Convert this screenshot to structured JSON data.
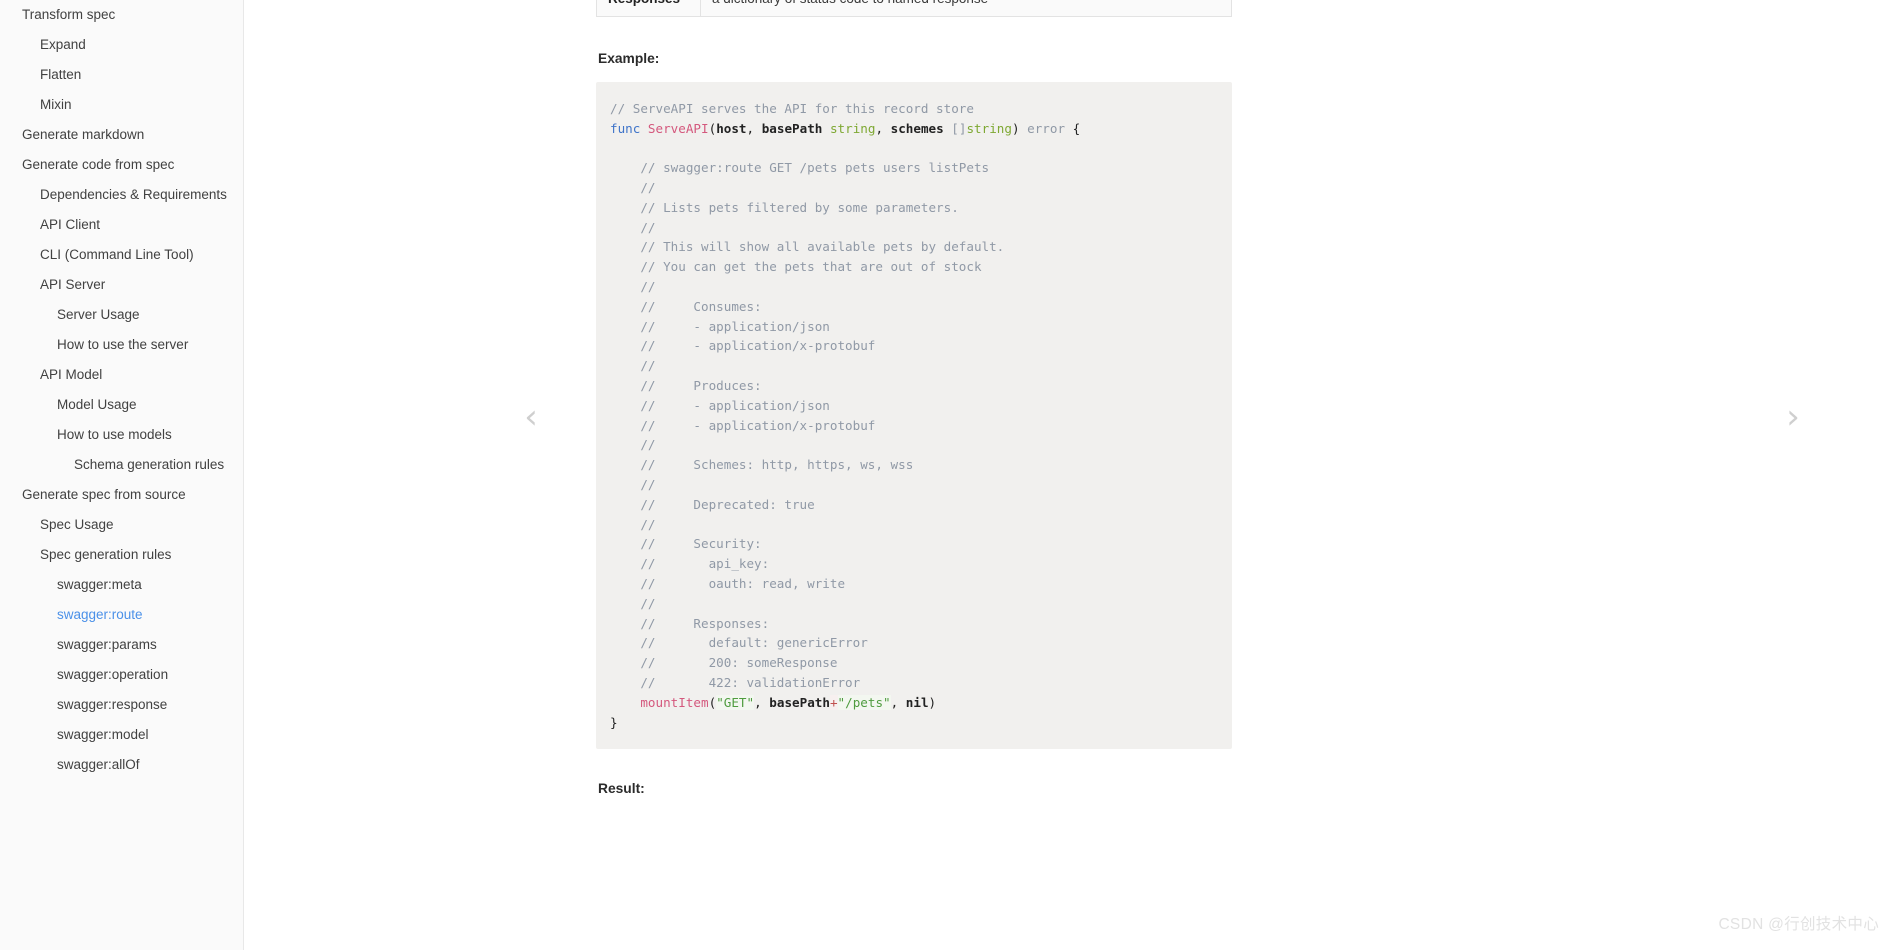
{
  "sidebar": {
    "items": [
      {
        "label": "Transform spec",
        "level": 0,
        "active": false
      },
      {
        "label": "Expand",
        "level": 1,
        "active": false
      },
      {
        "label": "Flatten",
        "level": 1,
        "active": false
      },
      {
        "label": "Mixin",
        "level": 1,
        "active": false
      },
      {
        "label": "Generate markdown",
        "level": 0,
        "active": false
      },
      {
        "label": "Generate code from spec",
        "level": 0,
        "active": false
      },
      {
        "label": "Dependencies & Requirements",
        "level": 1,
        "active": false
      },
      {
        "label": "API Client",
        "level": 1,
        "active": false
      },
      {
        "label": "CLI (Command Line Tool)",
        "level": 1,
        "active": false
      },
      {
        "label": "API Server",
        "level": 1,
        "active": false
      },
      {
        "label": "Server Usage",
        "level": 2,
        "active": false
      },
      {
        "label": "How to use the server",
        "level": 2,
        "active": false
      },
      {
        "label": "API Model",
        "level": 1,
        "active": false
      },
      {
        "label": "Model Usage",
        "level": 2,
        "active": false
      },
      {
        "label": "How to use models",
        "level": 2,
        "active": false
      },
      {
        "label": "Schema generation rules",
        "level": 3,
        "active": false
      },
      {
        "label": "Generate spec from source",
        "level": 0,
        "active": false
      },
      {
        "label": "Spec Usage",
        "level": 1,
        "active": false
      },
      {
        "label": "Spec generation rules",
        "level": 1,
        "active": false
      },
      {
        "label": "swagger:meta",
        "level": 2,
        "active": false
      },
      {
        "label": "swagger:route",
        "level": 2,
        "active": true
      },
      {
        "label": "swagger:params",
        "level": 2,
        "active": false
      },
      {
        "label": "swagger:operation",
        "level": 2,
        "active": false
      },
      {
        "label": "swagger:response",
        "level": 2,
        "active": false
      },
      {
        "label": "swagger:model",
        "level": 2,
        "active": false
      },
      {
        "label": "swagger:allOf",
        "level": 2,
        "active": false
      }
    ]
  },
  "main": {
    "table_row": {
      "key": "Responses",
      "value": "a dictionary of status code to named response"
    },
    "example_heading": "Example:",
    "result_heading": "Result:",
    "code_lines": [
      [
        {
          "t": "// ServeAPI serves the API for this record store",
          "c": "c-cmt"
        }
      ],
      [
        {
          "t": "func ",
          "c": "c-kw"
        },
        {
          "t": "ServeAPI",
          "c": "c-fn"
        },
        {
          "t": "(",
          "c": "c-pn"
        },
        {
          "t": "host",
          "c": "c-pl"
        },
        {
          "t": ", ",
          "c": "c-pn"
        },
        {
          "t": "basePath ",
          "c": "c-pl"
        },
        {
          "t": "string",
          "c": "c-typ"
        },
        {
          "t": ", ",
          "c": "c-pn"
        },
        {
          "t": "schemes ",
          "c": "c-pl"
        },
        {
          "t": "[]",
          "c": "c-cmt"
        },
        {
          "t": "string",
          "c": "c-typ"
        },
        {
          "t": ") ",
          "c": "c-pn"
        },
        {
          "t": "error",
          "c": "c-cmt"
        },
        {
          "t": " {",
          "c": "c-pn"
        }
      ],
      [
        {
          "t": "",
          "c": "c-cmt"
        }
      ],
      [
        {
          "t": "    // swagger:route GET /pets pets users listPets",
          "c": "c-cmt"
        }
      ],
      [
        {
          "t": "    //",
          "c": "c-cmt"
        }
      ],
      [
        {
          "t": "    // Lists pets filtered by some parameters.",
          "c": "c-cmt"
        }
      ],
      [
        {
          "t": "    //",
          "c": "c-cmt"
        }
      ],
      [
        {
          "t": "    // This will show all available pets by default.",
          "c": "c-cmt"
        }
      ],
      [
        {
          "t": "    // You can get the pets that are out of stock",
          "c": "c-cmt"
        }
      ],
      [
        {
          "t": "    //",
          "c": "c-cmt"
        }
      ],
      [
        {
          "t": "    //     Consumes:",
          "c": "c-cmt"
        }
      ],
      [
        {
          "t": "    //     - application/json",
          "c": "c-cmt"
        }
      ],
      [
        {
          "t": "    //     - application/x-protobuf",
          "c": "c-cmt"
        }
      ],
      [
        {
          "t": "    //",
          "c": "c-cmt"
        }
      ],
      [
        {
          "t": "    //     Produces:",
          "c": "c-cmt"
        }
      ],
      [
        {
          "t": "    //     - application/json",
          "c": "c-cmt"
        }
      ],
      [
        {
          "t": "    //     - application/x-protobuf",
          "c": "c-cmt"
        }
      ],
      [
        {
          "t": "    //",
          "c": "c-cmt"
        }
      ],
      [
        {
          "t": "    //     Schemes: http, https, ws, wss",
          "c": "c-cmt"
        }
      ],
      [
        {
          "t": "    //",
          "c": "c-cmt"
        }
      ],
      [
        {
          "t": "    //     Deprecated: true",
          "c": "c-cmt"
        }
      ],
      [
        {
          "t": "    //",
          "c": "c-cmt"
        }
      ],
      [
        {
          "t": "    //     Security:",
          "c": "c-cmt"
        }
      ],
      [
        {
          "t": "    //       api_key:",
          "c": "c-cmt"
        }
      ],
      [
        {
          "t": "    //       oauth: read, write",
          "c": "c-cmt"
        }
      ],
      [
        {
          "t": "    //",
          "c": "c-cmt"
        }
      ],
      [
        {
          "t": "    //     Responses:",
          "c": "c-cmt"
        }
      ],
      [
        {
          "t": "    //       default: genericError",
          "c": "c-cmt"
        }
      ],
      [
        {
          "t": "    //       200: someResponse",
          "c": "c-cmt"
        }
      ],
      [
        {
          "t": "    //       422: validationError",
          "c": "c-cmt"
        }
      ],
      [
        {
          "t": "    ",
          "c": "c-pn"
        },
        {
          "t": "mountItem",
          "c": "c-fn"
        },
        {
          "t": "(",
          "c": "c-pn"
        },
        {
          "t": "\"GET\"",
          "c": "c-str"
        },
        {
          "t": ", ",
          "c": "c-pn"
        },
        {
          "t": "basePath",
          "c": "c-pl"
        },
        {
          "t": "+",
          "c": "c-op"
        },
        {
          "t": "\"/pets\"",
          "c": "c-str"
        },
        {
          "t": ", ",
          "c": "c-pn"
        },
        {
          "t": "nil",
          "c": "c-nil"
        },
        {
          "t": ")",
          "c": "c-pn"
        }
      ],
      [
        {
          "t": "}",
          "c": "c-pn"
        }
      ]
    ]
  },
  "nav": {
    "prev_icon": "chevron-left-icon",
    "next_icon": "chevron-right-icon"
  },
  "watermark": "CSDN @行创技术中心"
}
